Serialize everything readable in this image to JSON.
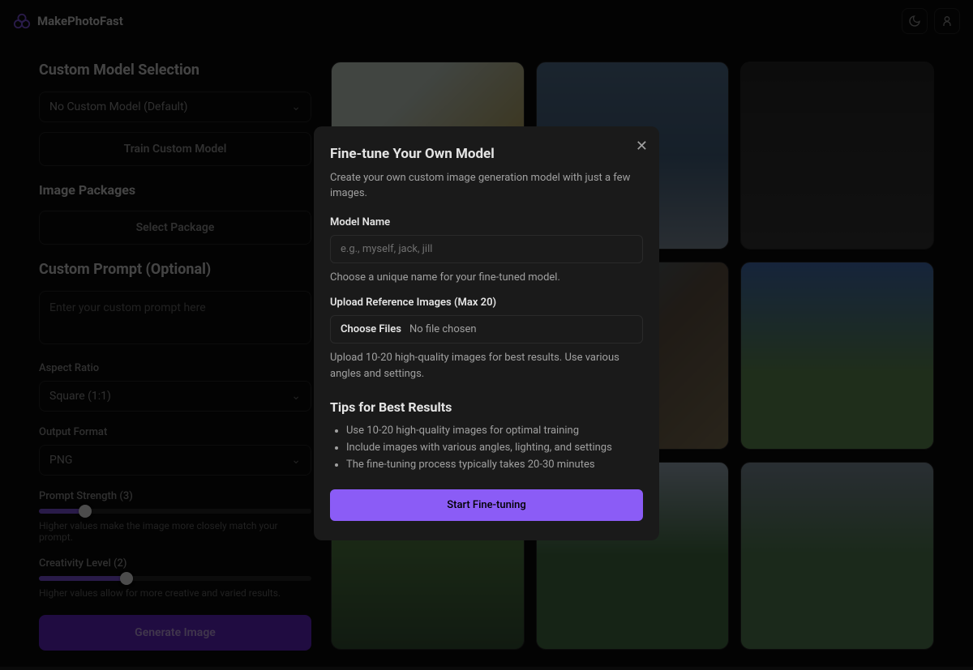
{
  "header": {
    "brand": "MakePhotoFast"
  },
  "sidebar": {
    "model_section_title": "Custom Model Selection",
    "model_select_value": "No Custom Model (Default)",
    "train_button": "Train Custom Model",
    "packages_title": "Image Packages",
    "select_package_button": "Select Package",
    "prompt_title": "Custom Prompt (Optional)",
    "prompt_placeholder": "Enter your custom prompt here",
    "aspect_label": "Aspect Ratio",
    "aspect_value": "Square (1:1)",
    "format_label": "Output Format",
    "format_value": "PNG",
    "strength_label": "Prompt Strength (3)",
    "strength_help": "Higher values make the image more closely match your prompt.",
    "creativity_label": "Creativity Level (2)",
    "creativity_help": "Higher values allow for more creative and varied results.",
    "generate_button": "Generate Image",
    "strength_pct": 17,
    "creativity_pct": 32
  },
  "modal": {
    "title": "Fine-tune Your Own Model",
    "subtitle": "Create your own custom image generation model with just a few images.",
    "name_label": "Model Name",
    "name_placeholder": "e.g., myself, jack, jill",
    "name_help": "Choose a unique name for your fine-tuned model.",
    "upload_label": "Upload Reference Images (Max 20)",
    "choose_files": "Choose Files",
    "file_status": "No file chosen",
    "upload_help": "Upload 10-20 high-quality images for best results. Use various angles and settings.",
    "tips_title": "Tips for Best Results",
    "tips": [
      "Use 10-20 high-quality images for optimal training",
      "Include images with various angles, lighting, and settings",
      "The fine-tuning process typically takes 20-30 minutes"
    ],
    "start_button": "Start Fine-tuning"
  }
}
